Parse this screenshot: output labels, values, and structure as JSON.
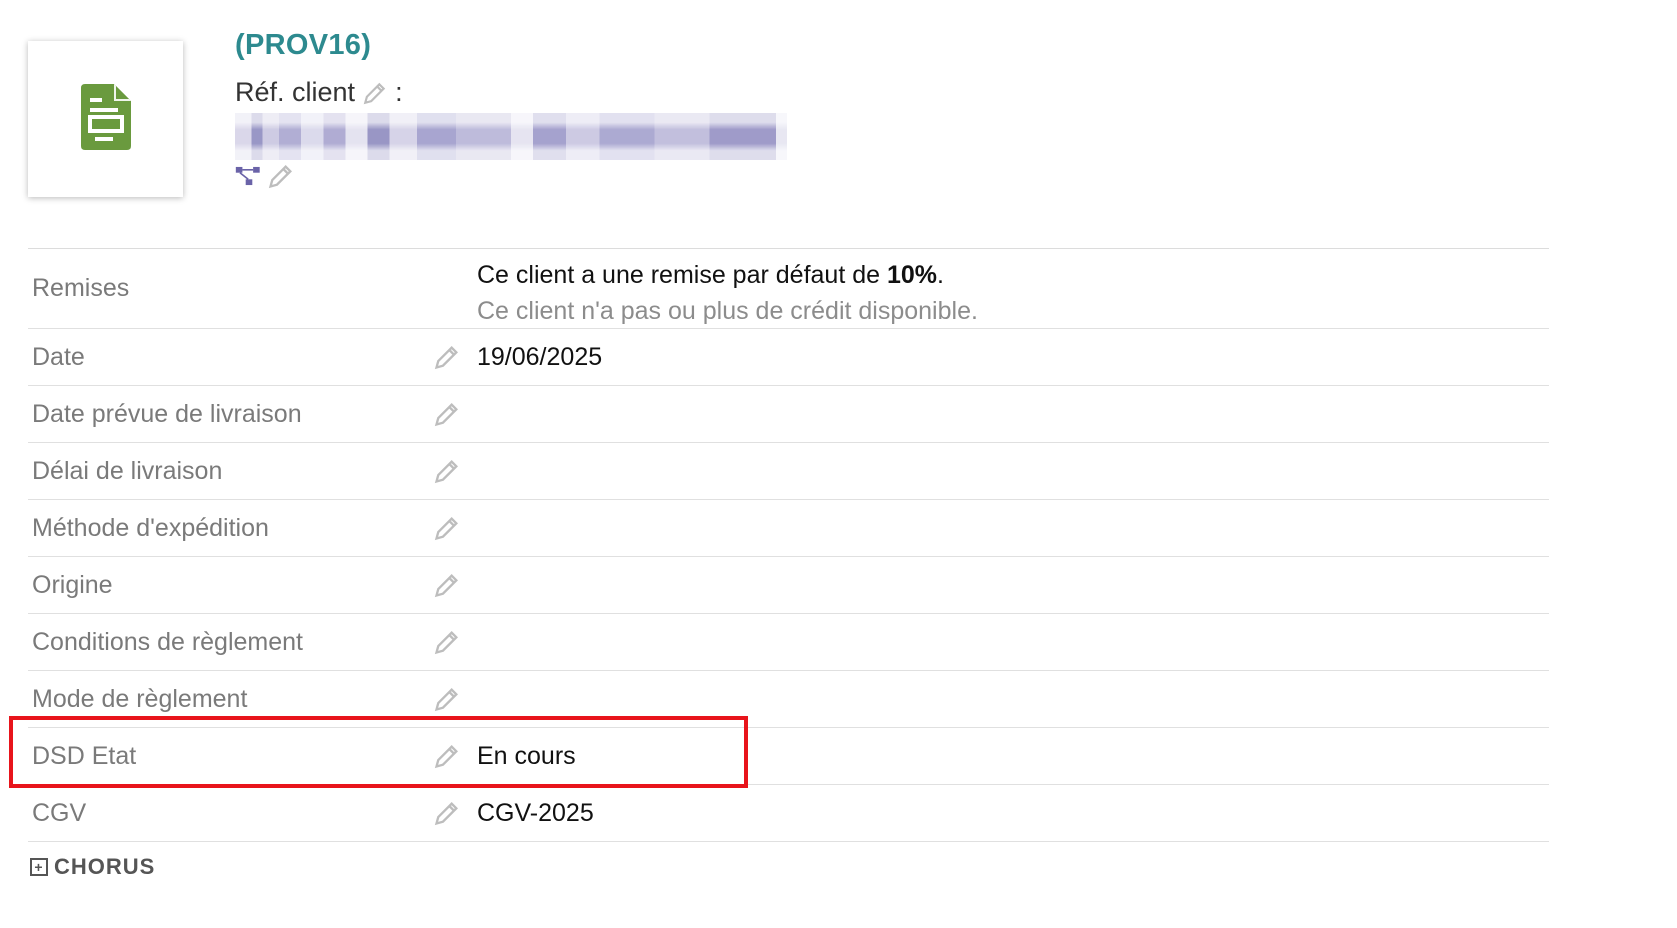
{
  "header": {
    "ref": "(PROV16)",
    "ref_client_label": "Réf. client",
    "ref_client_sep": ":",
    "doc_icon": "document-icon",
    "link_icon": "linked-objects-icon",
    "edit_icon": "pencil-icon",
    "accent_color": "#2d8a8f",
    "icon_color": "#6a9a3e"
  },
  "fields": {
    "remises": {
      "label": "Remises",
      "line1_prefix": "Ce client a une remise par défaut de ",
      "line1_bold": "10%",
      "line1_suffix": ".",
      "line2": "Ce client n'a pas ou plus de crédit disponible."
    },
    "date": {
      "label": "Date",
      "value": "19/06/2025"
    },
    "date_livraison": {
      "label": "Date prévue de livraison",
      "value": ""
    },
    "delai_livraison": {
      "label": "Délai de livraison",
      "value": ""
    },
    "methode_expedition": {
      "label": "Méthode d'expédition",
      "value": ""
    },
    "origine": {
      "label": "Origine",
      "value": ""
    },
    "conditions_reglement": {
      "label": "Conditions de règlement",
      "value": ""
    },
    "mode_reglement": {
      "label": "Mode de règlement",
      "value": ""
    },
    "dsd_etat": {
      "label": "DSD Etat",
      "value": "En cours"
    },
    "cgv": {
      "label": "CGV",
      "value": "CGV-2025"
    }
  },
  "section": {
    "chorus_label": "CHORUS",
    "toggle_symbol": "+"
  },
  "highlight_color": "#e8141b"
}
